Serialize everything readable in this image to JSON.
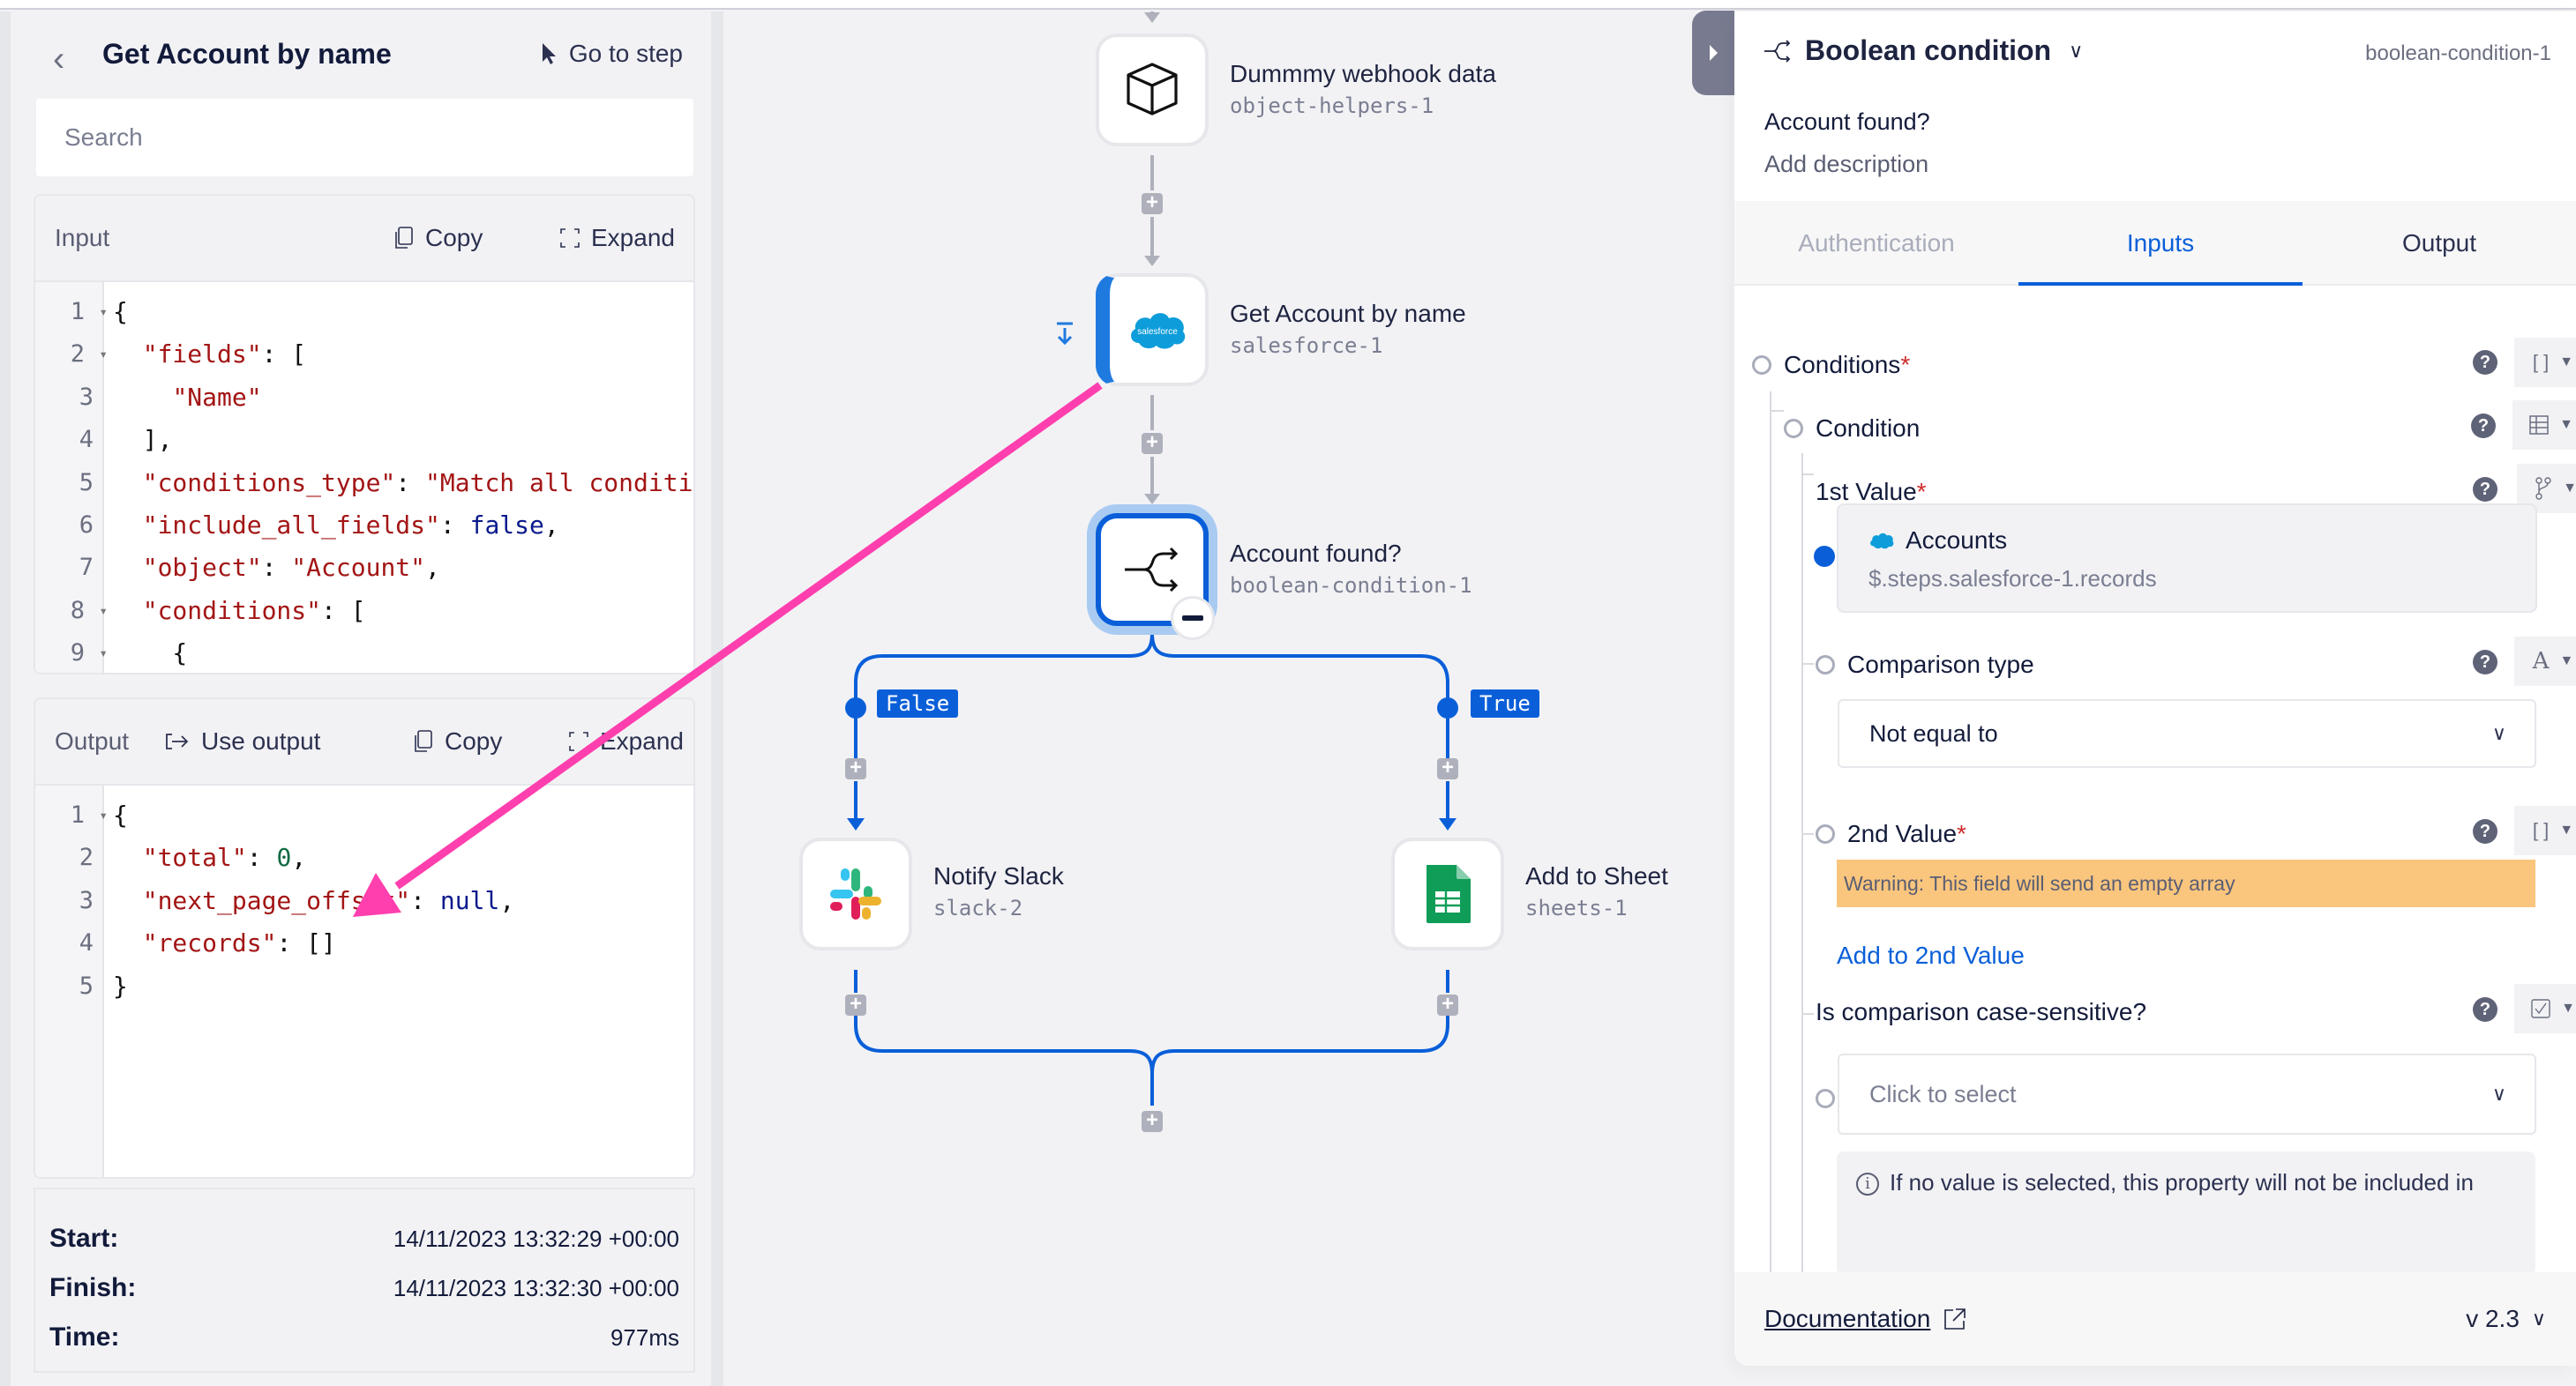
{
  "left_panel": {
    "title": "Get Account by name",
    "goto_step": "Go to step",
    "search_placeholder": "Search",
    "input": {
      "label": "Input",
      "copy": "Copy",
      "expand": "Expand",
      "lines": [
        {
          "n": "1",
          "fold": true,
          "html": "{"
        },
        {
          "n": "2",
          "fold": true,
          "html": "  <span class='k'>\"fields\"</span>: ["
        },
        {
          "n": "3",
          "fold": false,
          "html": "    <span class='s'>\"Name\"</span>"
        },
        {
          "n": "4",
          "fold": false,
          "html": "  ],"
        },
        {
          "n": "5",
          "fold": false,
          "html": "  <span class='k'>\"conditions_type\"</span>: <span class='s'>\"Match all conditions\"</span>,"
        },
        {
          "n": "6",
          "fold": false,
          "html": "  <span class='k'>\"include_all_fields\"</span>: <span class='b'>false</span>,"
        },
        {
          "n": "7",
          "fold": false,
          "html": "  <span class='k'>\"object\"</span>: <span class='s'>\"Account\"</span>,"
        },
        {
          "n": "8",
          "fold": true,
          "html": "  <span class='k'>\"conditions\"</span>: ["
        },
        {
          "n": "9",
          "fold": true,
          "html": "    {"
        }
      ]
    },
    "output": {
      "label": "Output",
      "use_output": "Use output",
      "copy": "Copy",
      "expand": "Expand",
      "lines": [
        {
          "n": "1",
          "fold": true,
          "html": "{"
        },
        {
          "n": "2",
          "fold": false,
          "html": "  <span class='k'>\"total\"</span>: <span class='n'>0</span>,"
        },
        {
          "n": "3",
          "fold": false,
          "html": "  <span class='k'>\"next_page_offset\"</span>: <span class='b'>null</span>,"
        },
        {
          "n": "4",
          "fold": false,
          "html": "  <span class='k'>\"records\"</span>: []"
        },
        {
          "n": "5",
          "fold": false,
          "html": "}"
        }
      ]
    },
    "meta": {
      "start_label": "Start:",
      "start_value": "14/11/2023 13:32:29 +00:00",
      "finish_label": "Finish:",
      "finish_value": "14/11/2023 13:32:30 +00:00",
      "time_label": "Time:",
      "time_value": "977ms"
    }
  },
  "canvas": {
    "nodes": [
      {
        "title": "Dummmy webhook data",
        "slug": "object-helpers-1",
        "icon": "cube-icon"
      },
      {
        "title": "Get Account by name",
        "slug": "salesforce-1",
        "icon": "salesforce-icon",
        "logo_text": "salesforce"
      },
      {
        "title": "Account found?",
        "slug": "boolean-condition-1",
        "icon": "branch-icon"
      },
      {
        "title": "Notify Slack",
        "slug": "slack-2",
        "icon": "slack-icon"
      },
      {
        "title": "Add to Sheet",
        "slug": "sheets-1",
        "icon": "google-sheets-icon"
      }
    ],
    "branches": {
      "false_label": "False",
      "true_label": "True"
    },
    "colors": {
      "branch": "#0a5fd9",
      "connector": "#aeb0bb",
      "annotation": "#ff3fae"
    }
  },
  "right_panel": {
    "step_type": "Boolean condition",
    "step_id": "boolean-condition-1",
    "step_name": "Account found?",
    "description_placeholder": "Add description",
    "tabs": [
      {
        "label": "Authentication",
        "state": "disabled"
      },
      {
        "label": "Inputs",
        "state": "active"
      },
      {
        "label": "Output",
        "state": "normal"
      }
    ],
    "fields": {
      "conditions": {
        "label": "Conditions",
        "required": "*"
      },
      "condition": {
        "label": "Condition"
      },
      "first_value": {
        "label": "1st Value",
        "required": "*",
        "ref_title": "Accounts",
        "ref_path": "$.steps.salesforce-1.records"
      },
      "comparison_type": {
        "label": "Comparison type",
        "value": "Not equal to",
        "type_glyph": "A"
      },
      "second_value": {
        "label": "2nd Value",
        "required": "*",
        "warning": "Warning: This field will send an empty array",
        "add_link": "Add to 2nd Value"
      },
      "case_sensitive": {
        "label": "Is comparison case-sensitive?",
        "placeholder": "Click to select",
        "info": "If no value is selected, this property will not be included in"
      }
    },
    "footer": {
      "documentation": "Documentation",
      "version": "v 2.3"
    }
  }
}
